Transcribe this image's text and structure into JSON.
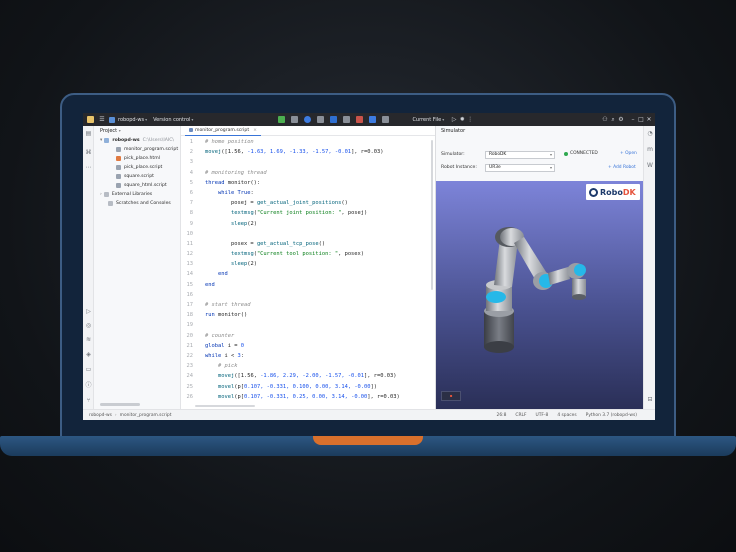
{
  "titlebar": {
    "project_name": "robopd-ws",
    "vcs_label": "Version control",
    "run_config": "Current File"
  },
  "project_panel": {
    "title": "Project",
    "root": {
      "name": "robopd-ws",
      "path": "C:\\Users\\IAIC\\"
    },
    "files": [
      "monitor_program.script",
      "pick_place.html",
      "pick_place.script",
      "square.script",
      "square_html.script"
    ],
    "external": "External Libraries",
    "scratches": "Scratches and Consoles"
  },
  "editor": {
    "tab_label": "monitor_program.script",
    "lines": [
      [
        {
          "c": "comment",
          "t": "# home position"
        }
      ],
      [
        {
          "c": "fn",
          "t": "movej"
        },
        {
          "c": "id",
          "t": "([1.56, "
        },
        {
          "c": "num",
          "t": "-1.63, 1.69, -1.33, -1.57, -0.01"
        },
        {
          "c": "id",
          "t": "], r=0.03)"
        }
      ],
      [],
      [
        {
          "c": "comment",
          "t": "# monitoring thread"
        }
      ],
      [
        {
          "c": "kw",
          "t": "thread "
        },
        {
          "c": "id",
          "t": "monitor():"
        }
      ],
      [
        {
          "c": "id",
          "t": "    "
        },
        {
          "c": "kw",
          "t": "while True"
        },
        {
          "c": "id",
          "t": ":"
        }
      ],
      [
        {
          "c": "id",
          "t": "        posej = "
        },
        {
          "c": "fn",
          "t": "get_actual_joint_positions"
        },
        {
          "c": "id",
          "t": "()"
        }
      ],
      [
        {
          "c": "id",
          "t": "        "
        },
        {
          "c": "fn",
          "t": "textmsg"
        },
        {
          "c": "id",
          "t": "("
        },
        {
          "c": "str",
          "t": "\"Current joint position: \""
        },
        {
          "c": "id",
          "t": ", posej)"
        }
      ],
      [
        {
          "c": "id",
          "t": "        "
        },
        {
          "c": "fn",
          "t": "sleep"
        },
        {
          "c": "id",
          "t": "(2)"
        }
      ],
      [],
      [
        {
          "c": "id",
          "t": "        posex = "
        },
        {
          "c": "fn",
          "t": "get_actual_tcp_pose"
        },
        {
          "c": "id",
          "t": "()"
        }
      ],
      [
        {
          "c": "id",
          "t": "        "
        },
        {
          "c": "fn",
          "t": "textmsg"
        },
        {
          "c": "id",
          "t": "("
        },
        {
          "c": "str",
          "t": "\"Current tool position: \""
        },
        {
          "c": "id",
          "t": ", posex)"
        }
      ],
      [
        {
          "c": "id",
          "t": "        "
        },
        {
          "c": "fn",
          "t": "sleep"
        },
        {
          "c": "id",
          "t": "(2)"
        }
      ],
      [
        {
          "c": "id",
          "t": "    "
        },
        {
          "c": "kw",
          "t": "end"
        }
      ],
      [
        {
          "c": "kw",
          "t": "end"
        }
      ],
      [],
      [
        {
          "c": "comment",
          "t": "# start thread"
        }
      ],
      [
        {
          "c": "kw",
          "t": "run "
        },
        {
          "c": "id",
          "t": "monitor()"
        }
      ],
      [],
      [
        {
          "c": "comment",
          "t": "# counter"
        }
      ],
      [
        {
          "c": "kw",
          "t": "global "
        },
        {
          "c": "id",
          "t": "i = "
        },
        {
          "c": "num",
          "t": "0"
        }
      ],
      [
        {
          "c": "kw",
          "t": "while "
        },
        {
          "c": "id",
          "t": "i < "
        },
        {
          "c": "num",
          "t": "3"
        },
        {
          "c": "id",
          "t": ":"
        }
      ],
      [
        {
          "c": "id",
          "t": "    "
        },
        {
          "c": "comment",
          "t": "# pick"
        }
      ],
      [
        {
          "c": "id",
          "t": "    "
        },
        {
          "c": "fn",
          "t": "movej"
        },
        {
          "c": "id",
          "t": "([1.56, "
        },
        {
          "c": "num",
          "t": "-1.86, 2.29, -2.00, -1.57, -0.01"
        },
        {
          "c": "id",
          "t": "], r=0.03)"
        }
      ],
      [
        {
          "c": "id",
          "t": "    "
        },
        {
          "c": "fn",
          "t": "movel"
        },
        {
          "c": "id",
          "t": "(p["
        },
        {
          "c": "num",
          "t": "0.107, -0.331, 0.100, 0.00, 3.14, -0.00"
        },
        {
          "c": "id",
          "t": "])"
        }
      ],
      [
        {
          "c": "id",
          "t": "    "
        },
        {
          "c": "fn",
          "t": "movel"
        },
        {
          "c": "id",
          "t": "(p["
        },
        {
          "c": "num",
          "t": "0.107, -0.331, 0.25, 0.00, 3.14, -0.00"
        },
        {
          "c": "id",
          "t": "], r=0.03)"
        }
      ]
    ]
  },
  "simulator": {
    "title": "Simulator",
    "simulator_label": "Simulator:",
    "simulator_value": "RoboDK",
    "robot_label": "Robot Instance:",
    "robot_value": "UR3e",
    "status": "CONNECTED",
    "open_label": "+ Open",
    "add_robot_label": "+ Add Robot",
    "logo_text_a": "Robo",
    "logo_text_b": "DK"
  },
  "statusbar": {
    "crumb_a": "robopd-ws",
    "crumb_b": "monitor_program.script",
    "position": "26:8",
    "line_sep": "CRLF",
    "encoding": "UTF-8",
    "indent": "4 spaces",
    "interpreter": "Python 3.7 (robopd-ws)"
  },
  "colors": {
    "accent": "#3874d8",
    "connected": "#2fa84f",
    "laptop_accent": "#d9702c"
  }
}
